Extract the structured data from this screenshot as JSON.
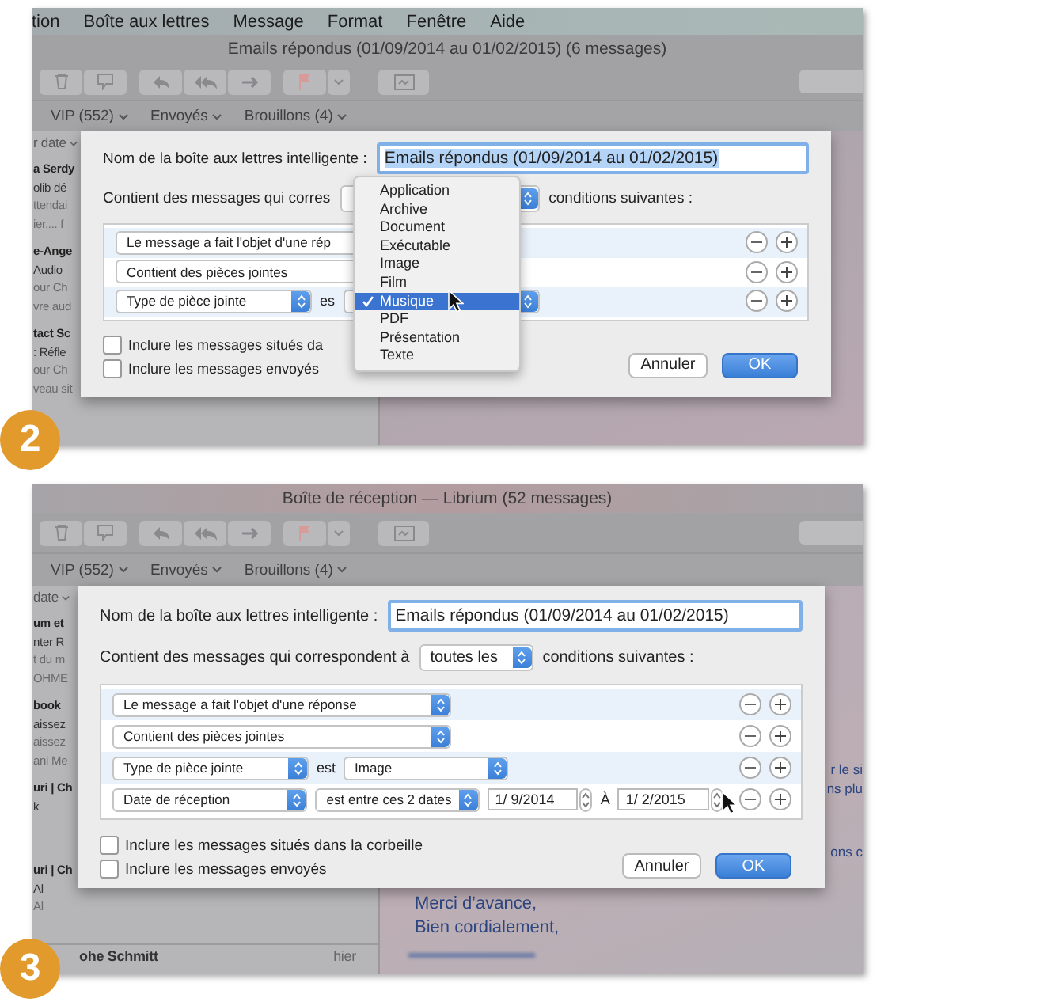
{
  "panels": [
    {
      "badge": "2",
      "menubar": [
        "tion",
        "Boîte aux lettres",
        "Message",
        "Format",
        "Fenêtre",
        "Aide"
      ],
      "title": "Emails répondus (01/09/2014 au 01/02/2015) (6 messages)",
      "favorites": [
        "VIP (552)",
        "Envoyés",
        "Brouillons (4)"
      ],
      "sidebar": {
        "header": "r date",
        "groups": [
          {
            "lines": [
              {
                "kind": "bold",
                "text": "a Serdy"
              },
              {
                "kind": "plain",
                "text": "olib dé"
              },
              {
                "kind": "dim",
                "text": "ttendai"
              },
              {
                "kind": "dim",
                "text": "ier.... f"
              }
            ]
          },
          {
            "lines": [
              {
                "kind": "bold",
                "text": "e-Ange"
              },
              {
                "kind": "plain",
                "text": "Audio"
              },
              {
                "kind": "dim",
                "text": "our Ch"
              },
              {
                "kind": "dim",
                "text": "vre aud"
              }
            ]
          },
          {
            "lines": [
              {
                "kind": "bold",
                "text": "tact Sc"
              },
              {
                "kind": "plain",
                "text": ": Réfle"
              },
              {
                "kind": "dim",
                "text": "our Ch"
              },
              {
                "kind": "dim",
                "text": "veau sit"
              }
            ]
          }
        ]
      },
      "dialog": {
        "name_label": "Nom de la boîte aux lettres intelligente :",
        "name_value": "Emails répondus (01/09/2014 au 01/02/2015)",
        "name_highlighted": true,
        "match_prefix": "Contient des messages qui corres",
        "match_suffix": "conditions suivantes :",
        "rules": [
          {
            "parts": [
              {
                "kind": "popup",
                "value": "Le message a fait l'objet d'une rép"
              }
            ]
          },
          {
            "parts": [
              {
                "kind": "popup",
                "value": "Contient des pièces jointes"
              }
            ]
          },
          {
            "parts": [
              {
                "kind": "popup",
                "value": "Type de pièce jointe"
              },
              {
                "kind": "label",
                "text": "es"
              },
              {
                "kind": "popup"
              }
            ]
          }
        ],
        "checkboxes": [
          {
            "label": "Inclure les messages situés da",
            "checked": false
          },
          {
            "label": "Inclure les messages envoyés",
            "checked": false
          }
        ],
        "buttons": [
          {
            "label": "Annuler",
            "kind": "cancel"
          },
          {
            "label": "OK",
            "kind": "default"
          }
        ]
      },
      "menu": {
        "items": [
          {
            "label": "Application",
            "selected": false
          },
          {
            "label": "Archive",
            "selected": false
          },
          {
            "label": "Document",
            "selected": false
          },
          {
            "label": "Exécutable",
            "selected": false
          },
          {
            "label": "Image",
            "selected": false
          },
          {
            "label": "Film",
            "selected": false
          },
          {
            "label": "Musique",
            "selected": true
          },
          {
            "label": "PDF",
            "selected": false
          },
          {
            "label": "Présentation",
            "selected": false
          },
          {
            "label": "Texte",
            "selected": false
          }
        ]
      }
    },
    {
      "badge": "3",
      "title": "Boîte de réception — Librium (52 messages)",
      "favorites": [
        "VIP (552)",
        "Envoyés",
        "Brouillons (4)"
      ],
      "sidebar": {
        "header": "date",
        "groups": [
          {
            "lines": [
              {
                "kind": "bold",
                "text": "um et"
              },
              {
                "kind": "plain",
                "text": "nter R"
              },
              {
                "kind": "dim",
                "text": "t du m"
              },
              {
                "kind": "dim",
                "text": "OHME"
              }
            ]
          },
          {
            "lines": [
              {
                "kind": "bold",
                "text": "book"
              },
              {
                "kind": "plain",
                "text": "aissez"
              },
              {
                "kind": "dim",
                "text": "aissez"
              },
              {
                "kind": "dim",
                "text": "ani Me"
              }
            ]
          },
          {
            "lines": [
              {
                "kind": "bold",
                "text": "uri | Ch"
              },
              {
                "kind": "plain",
                "text": "k"
              }
            ]
          },
          {
            "lines": [
              {
                "kind": "bold",
                "text": "uri | Ch"
              },
              {
                "kind": "plain",
                "text": "Al"
              },
              {
                "kind": "dim",
                "text": "Al"
              }
            ]
          },
          {
            "lines": [
              {
                "kind": "row",
                "text": "ohe Schmitt",
                "aside": "hier"
              }
            ]
          }
        ]
      },
      "reading": [
        {
          "kind": "fragment",
          "lines": [
            "r le si",
            "ns plu"
          ]
        },
        {
          "kind": "fragment",
          "lines": [
            "ons c"
          ]
        },
        {
          "kind": "closing",
          "lines": [
            "Merci d’avance,",
            "Bien cordialement,"
          ]
        }
      ],
      "dialog": {
        "name_label": "Nom de la boîte aux lettres intelligente :",
        "name_value": "Emails répondus (01/09/2014 au 01/02/2015)",
        "name_highlighted": false,
        "match_prefix": "Contient des messages qui correspondent à",
        "match_value": "toutes les",
        "match_suffix": "conditions suivantes :",
        "rules": [
          {
            "parts": [
              {
                "kind": "popup",
                "value": "Le message a fait l'objet d'une réponse"
              }
            ]
          },
          {
            "parts": [
              {
                "kind": "popup",
                "value": "Contient des pièces jointes"
              }
            ]
          },
          {
            "parts": [
              {
                "kind": "popup",
                "value": "Type de pièce jointe"
              },
              {
                "kind": "label",
                "text": "est"
              },
              {
                "kind": "popup",
                "value": "Image"
              }
            ]
          },
          {
            "parts": [
              {
                "kind": "popup",
                "value": "Date de réception"
              },
              {
                "kind": "popup",
                "value": "est entre ces 2 dates"
              },
              {
                "kind": "date",
                "value": "1/ 9/2014"
              },
              {
                "kind": "label",
                "text": "À"
              },
              {
                "kind": "date",
                "value": "1/ 2/2015"
              }
            ]
          }
        ],
        "checkboxes": [
          {
            "label": "Inclure les messages situés dans la corbeille",
            "checked": false
          },
          {
            "label": "Inclure les messages envoyés",
            "checked": false
          }
        ],
        "buttons": [
          {
            "label": "Annuler",
            "kind": "cancel"
          },
          {
            "label": "OK",
            "kind": "default"
          }
        ]
      }
    }
  ]
}
